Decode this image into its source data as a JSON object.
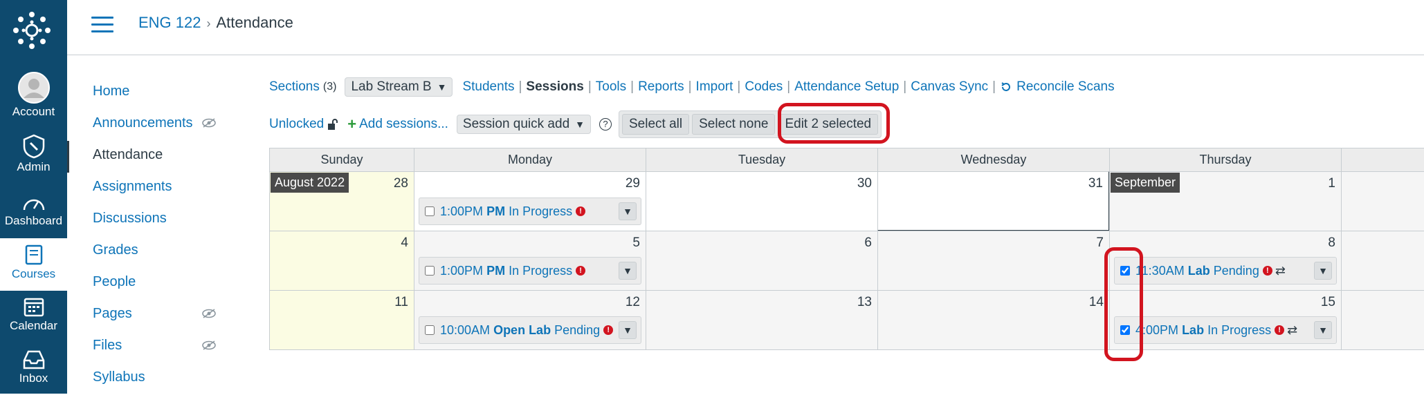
{
  "nav": {
    "account": "Account",
    "admin": "Admin",
    "dashboard": "Dashboard",
    "courses": "Courses",
    "calendar": "Calendar",
    "inbox": "Inbox"
  },
  "breadcrumb": {
    "course": "ENG 122",
    "separator": "›",
    "current": "Attendance"
  },
  "course_nav": [
    {
      "label": "Home"
    },
    {
      "label": "Announcements"
    },
    {
      "label": "Attendance"
    },
    {
      "label": "Assignments"
    },
    {
      "label": "Discussions"
    },
    {
      "label": "Grades"
    },
    {
      "label": "People"
    },
    {
      "label": "Pages"
    },
    {
      "label": "Files"
    },
    {
      "label": "Syllabus"
    }
  ],
  "toolbar1": {
    "sections": "Sections",
    "section_count": "(3)",
    "section_select": "Lab Stream B",
    "students": "Students",
    "sessions": "Sessions",
    "tools": "Tools",
    "reports": "Reports",
    "import": "Import",
    "codes": "Codes",
    "setup": "Attendance Setup",
    "sync": "Canvas Sync",
    "reconcile": "Reconcile Scans"
  },
  "toolbar2": {
    "unlocked": "Unlocked",
    "add_sessions": "Add sessions...",
    "quick_add": "Session quick add",
    "help": "?",
    "select_all": "Select all",
    "select_none": "Select none",
    "edit_selected": "Edit 2 selected"
  },
  "calendar": {
    "days": [
      "Sunday",
      "Monday",
      "Tuesday",
      "Wednesday",
      "Thursday"
    ],
    "month_aug": "August 2022",
    "month_sep": "September",
    "weeks": [
      [
        "28",
        "29",
        "30",
        "31",
        "1"
      ],
      [
        "4",
        "5",
        "6",
        "7",
        "8"
      ],
      [
        "11",
        "12",
        "13",
        "14",
        "15"
      ]
    ],
    "sessions": {
      "w1_mon": {
        "time": "1:00PM",
        "name": "PM",
        "status": "In Progress",
        "checked": false
      },
      "w2_mon": {
        "time": "1:00PM",
        "name": "PM",
        "status": "In Progress",
        "checked": false
      },
      "w2_thu": {
        "time": "11:30AM",
        "name": "Lab",
        "status": "Pending",
        "checked": true
      },
      "w3_mon": {
        "time": "10:00AM",
        "name": "Open Lab",
        "status": "Pending",
        "checked": false
      },
      "w3_thu": {
        "time": "4:00PM",
        "name": "Lab",
        "status": "In Progress",
        "checked": true
      }
    }
  },
  "colors": {
    "nav_bg": "#0e4a6e",
    "link": "#0e74b8",
    "highlight": "#d2141f"
  }
}
